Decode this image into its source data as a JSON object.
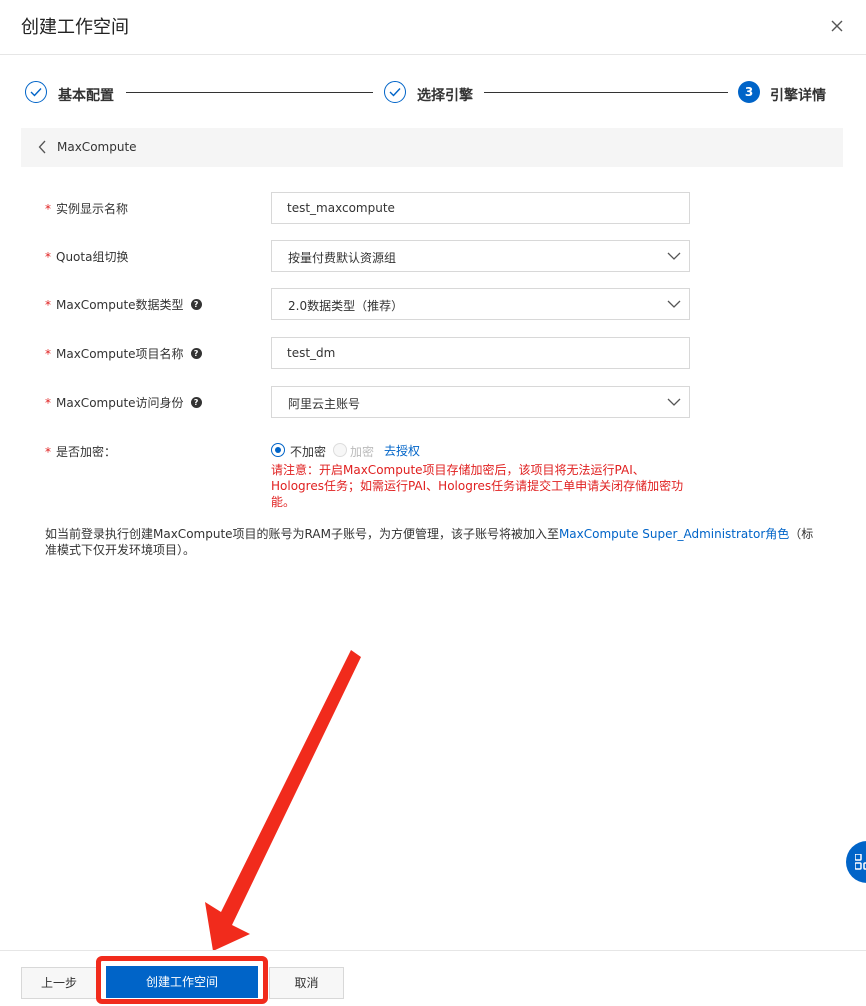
{
  "dialog": {
    "title": "创建工作空间"
  },
  "steps": [
    {
      "label": "基本配置",
      "status": "done"
    },
    {
      "label": "选择引擎",
      "status": "done"
    },
    {
      "label": "引擎详情",
      "status": "current",
      "number": "3"
    }
  ],
  "engine": {
    "name": "MaxCompute"
  },
  "form": {
    "instance_name": {
      "label": "实例显示名称",
      "value": "test_maxcompute"
    },
    "quota_group": {
      "label": "Quota组切换",
      "value": "按量付费默认资源组"
    },
    "data_type": {
      "label": "MaxCompute数据类型",
      "value": "2.0数据类型（推荐）"
    },
    "project_name": {
      "label": "MaxCompute项目名称",
      "value": "test_dm"
    },
    "access_identity": {
      "label": "MaxCompute访问身份",
      "value": "阿里云主账号"
    },
    "encryption": {
      "label": "是否加密：",
      "option_no": "不加密",
      "option_yes": "加密",
      "auth_link": "去授权",
      "warning": "请注意：开启MaxCompute项目存储加密后，该项目将无法运行PAI、Hologres任务；如需运行PAI、Hologres任务请提交工单申请关闭存储加密功能。"
    },
    "required_mark": "*"
  },
  "note": {
    "before": "如当前登录执行创建MaxCompute项目的账号为RAM子账号，为方便管理，该子账号将被加入至",
    "link": "MaxCompute Super_Administrator角色",
    "after": "（标准模式下仅开发环境项目）。"
  },
  "footer": {
    "prev": "上一步",
    "create": "创建工作空间",
    "cancel": "取消"
  },
  "colors": {
    "primary": "#0064c8",
    "danger": "#e02020",
    "annotation": "#f12b1c"
  }
}
